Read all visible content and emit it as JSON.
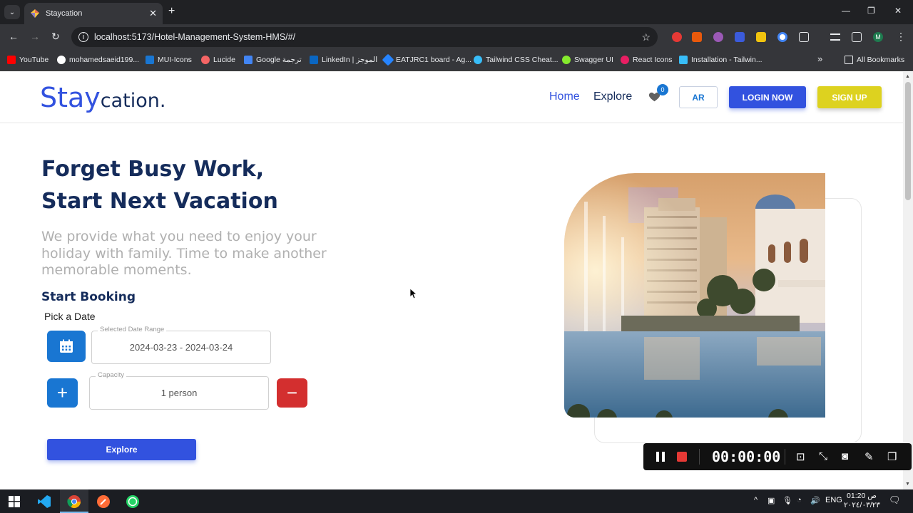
{
  "browser": {
    "tab_title": "Staycation",
    "tab_close": "✕",
    "new_tab": "+",
    "url": "localhost:5173/Hotel-Management-System-HMS/#/",
    "bookmarks": [
      {
        "label": "YouTube",
        "color": "#ff0000"
      },
      {
        "label": "mohamedsaeid199...",
        "color": "#ffffff"
      },
      {
        "label": "MUI-Icons",
        "color": "#1976d2"
      },
      {
        "label": "Lucide",
        "color": "#f56565"
      },
      {
        "label": "Google ترجمة",
        "color": "#4285f4"
      },
      {
        "label": "LinkedIn | الموجز",
        "color": "#0a66c2"
      },
      {
        "label": "EATJRC1 board - Ag...",
        "color": "#2684ff"
      },
      {
        "label": "Tailwind CSS Cheat...",
        "color": "#38bdf8"
      },
      {
        "label": "Swagger UI",
        "color": "#85ea2d"
      },
      {
        "label": "React Icons",
        "color": "#e91e63"
      },
      {
        "label": "Installation - Tailwin...",
        "color": "#38bdf8"
      }
    ],
    "bookmarks_overflow": "»",
    "all_bookmarks": "All Bookmarks",
    "profile_initial": "M"
  },
  "site": {
    "logo_stay": "Stay",
    "logo_cation": "cation.",
    "nav": {
      "home": "Home",
      "explore": "Explore"
    },
    "favorites_count": "0",
    "lang_button": "AR",
    "login_button": "LOGIN NOW",
    "signup_button": "SIGN UP",
    "colors": {
      "primary": "#3252df",
      "navy": "#152c5b",
      "yellow": "#ddd21f",
      "blue": "#1976d2",
      "red": "#d32f2f"
    }
  },
  "hero": {
    "title": "Forget Busy Work, Start Next Vacation",
    "subtitle": "We provide what you need to enjoy your holiday with family. Time to make another memorable moments.",
    "start_booking": "Start Booking",
    "pick_date": "Pick a Date",
    "date_range_label": "Selected Date Range",
    "date_range_value": "2024-03-23 - 2024-03-24",
    "capacity_label": "Capacity",
    "capacity_value": "1 person",
    "explore_button": "Explore"
  },
  "recorder": {
    "time": "00:00:00"
  },
  "taskbar": {
    "lang": "ENG",
    "time": "01:20 ص",
    "date": "٢٠٢٤/٠٣/٢٣"
  }
}
